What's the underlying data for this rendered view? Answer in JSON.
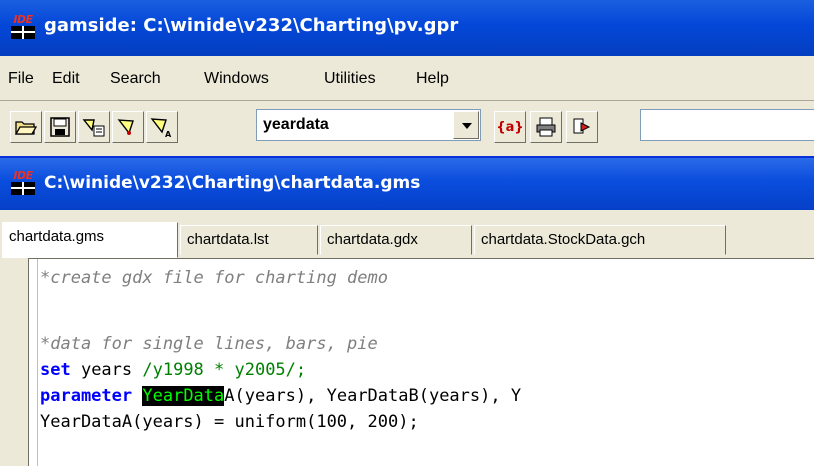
{
  "app": {
    "title": "gamside: C:\\winide\\v232\\Charting\\pv.gpr",
    "logo_text": "IDE"
  },
  "menu": {
    "items": [
      "File",
      "Edit",
      "Search",
      "Windows",
      "Utilities",
      "Help"
    ]
  },
  "toolbar": {
    "buttons": [
      "open-folder-icon",
      "save-disk-icon",
      "run-tools-icon",
      "run-icon",
      "run-all-icon"
    ],
    "combo_value": "yeardata",
    "extra_buttons": [
      "model-library-icon",
      "print-icon",
      "next-icon"
    ],
    "model_library_label": "{a}"
  },
  "document": {
    "title": "C:\\winide\\v232\\Charting\\chartdata.gms",
    "tabs": [
      "chartdata.gms",
      "chartdata.lst",
      "chartdata.gdx",
      "chartdata.StockData.gch"
    ],
    "active_tab": 0
  },
  "code": {
    "line1": "*create gdx file for charting demo",
    "line3": "*data for single lines, bars, pie",
    "line4_kw": "set",
    "line4_mid": " years ",
    "line4_green": "/y1998 * y2005/;",
    "line5_kw": "parameter",
    "line5_sp": " ",
    "line5_hl": "YearData",
    "line5_rest": "A(years), YearDataB(years), Y",
    "line6": "YearDataA(years) = uniform(100, 200);"
  },
  "colors": {
    "titlebar": "#0447d8",
    "keyword": "#0000ff",
    "comment": "#7f7f7f",
    "string": "#008000",
    "highlight_bg": "#000000",
    "highlight_fg": "#00ff00"
  }
}
